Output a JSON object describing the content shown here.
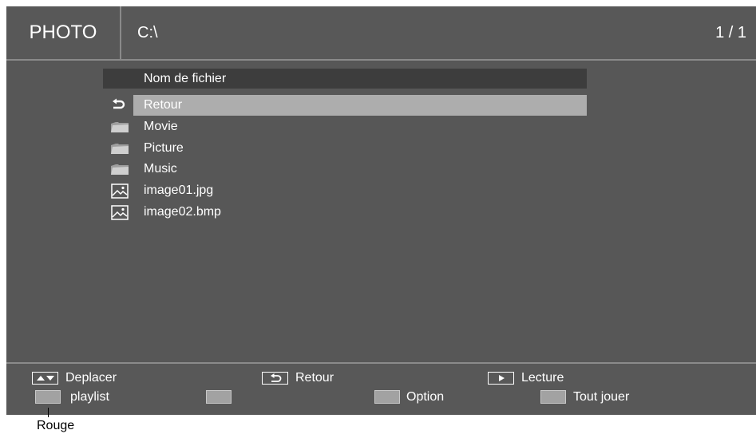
{
  "header": {
    "title": "PHOTO",
    "path": "C:\\",
    "page": "1 / 1"
  },
  "list": {
    "column_header": "Nom de fichier",
    "items": [
      {
        "label": "Retour",
        "icon": "return-icon",
        "selected": true
      },
      {
        "label": "Movie",
        "icon": "folder-icon"
      },
      {
        "label": "Picture",
        "icon": "folder-icon"
      },
      {
        "label": "Music",
        "icon": "folder-icon"
      },
      {
        "label": "image01.jpg",
        "icon": "image-file-icon"
      },
      {
        "label": "image02.bmp",
        "icon": "image-file-icon"
      }
    ]
  },
  "footer": {
    "move": "Deplacer",
    "back": "Retour",
    "play": "Lecture",
    "red": "playlist",
    "green": "",
    "yellow": "Option",
    "blue": "Tout jouer"
  },
  "callout": {
    "label": "Rouge"
  }
}
